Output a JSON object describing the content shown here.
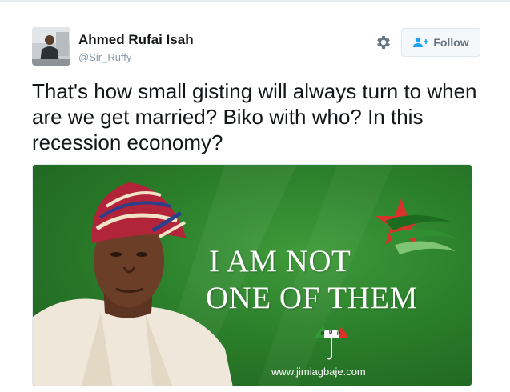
{
  "tweet": {
    "author_name": "Ahmed Rufai Isah",
    "author_handle": "@Sir_Ruffy",
    "text": "That's how small gisting will always turn to when are we get married? Biko with who? In this recession economy?"
  },
  "actions": {
    "follow_label": "Follow",
    "settings_icon": "gear-icon",
    "follow_icon": "person-plus-icon"
  },
  "media": {
    "headline_line1": "I AM NOT",
    "headline_line2": "ONE OF THEM",
    "website": "www.jimiagbaje.com",
    "logo_letters": [
      "P",
      "D",
      "P"
    ]
  },
  "colors": {
    "follow_icon": "#1da1f2",
    "banner_green": "#2b7f2b",
    "star_red": "#d9322a"
  }
}
